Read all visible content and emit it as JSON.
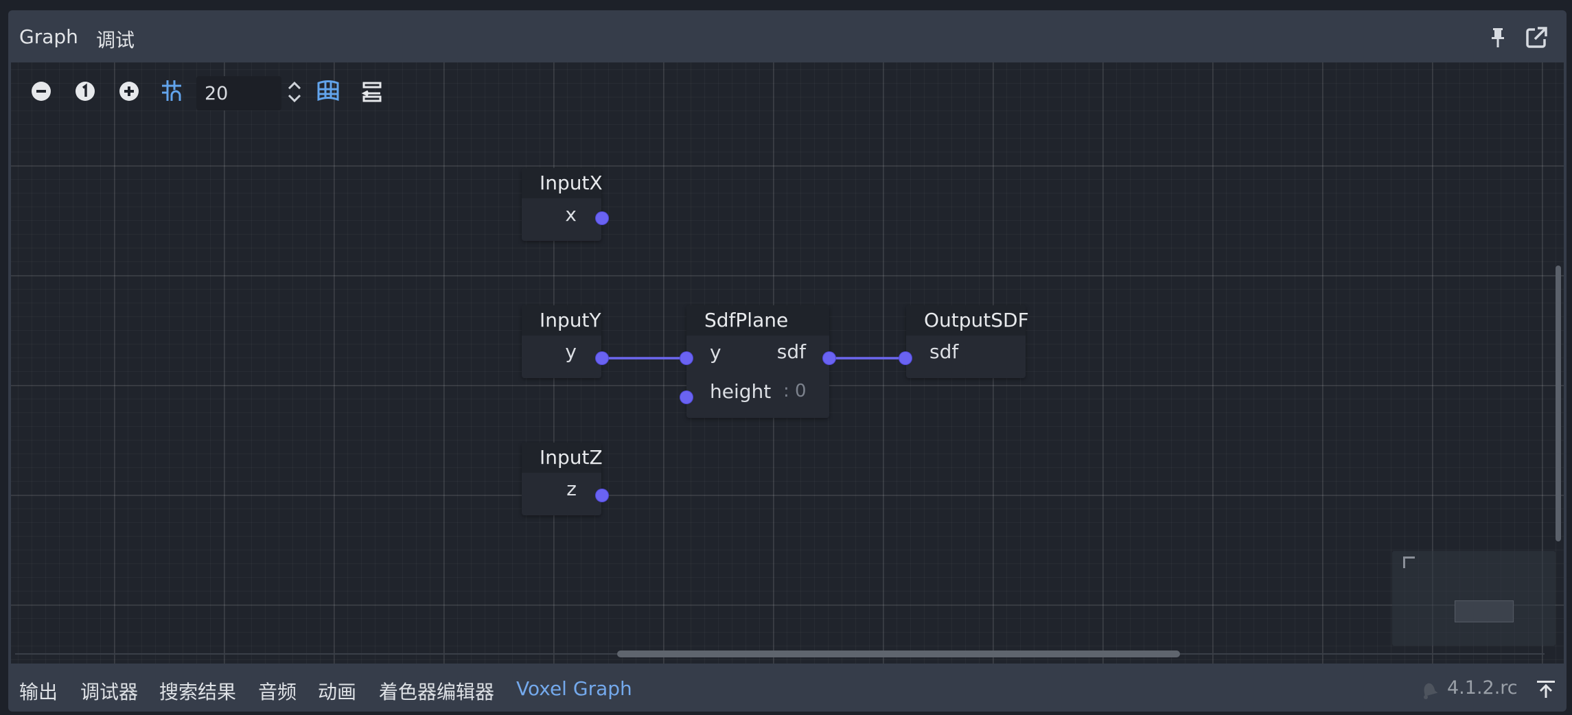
{
  "header": {
    "tabs": [
      {
        "label": "Graph"
      },
      {
        "label": "调试"
      }
    ]
  },
  "toolbar": {
    "zoom_out_icon": "minus-circle-icon",
    "zoom_reset_icon": "one-circle-icon",
    "zoom_in_icon": "plus-circle-icon",
    "snap_icon": "grid-snap-icon",
    "snap_distance": "20",
    "minimap_icon": "minimap-icon",
    "arrange_icon": "arrange-nodes-icon"
  },
  "nodes": {
    "input_x": {
      "title": "InputX",
      "output": "x"
    },
    "input_y": {
      "title": "InputY",
      "output": "y"
    },
    "input_z": {
      "title": "InputZ",
      "output": "z"
    },
    "sdf_plane": {
      "title": "SdfPlane",
      "input_y": "y",
      "output": "sdf",
      "input_height": "height",
      "height_value": ": 0"
    },
    "output_sdf": {
      "title": "OutputSDF",
      "input": "sdf"
    }
  },
  "bottom_bar": {
    "tabs": [
      {
        "label": "输出"
      },
      {
        "label": "调试器"
      },
      {
        "label": "搜索结果"
      },
      {
        "label": "音频"
      },
      {
        "label": "动画"
      },
      {
        "label": "着色器编辑器"
      },
      {
        "label": "Voxel Graph",
        "active": true
      }
    ],
    "version": "4.1.2.rc"
  },
  "colors": {
    "background": "#1d2129",
    "panel": "#363d4a",
    "graph_bg": "#20242c",
    "port": "#6a63f2",
    "wire": "#6c67ee",
    "accent": "#74a9ec"
  }
}
